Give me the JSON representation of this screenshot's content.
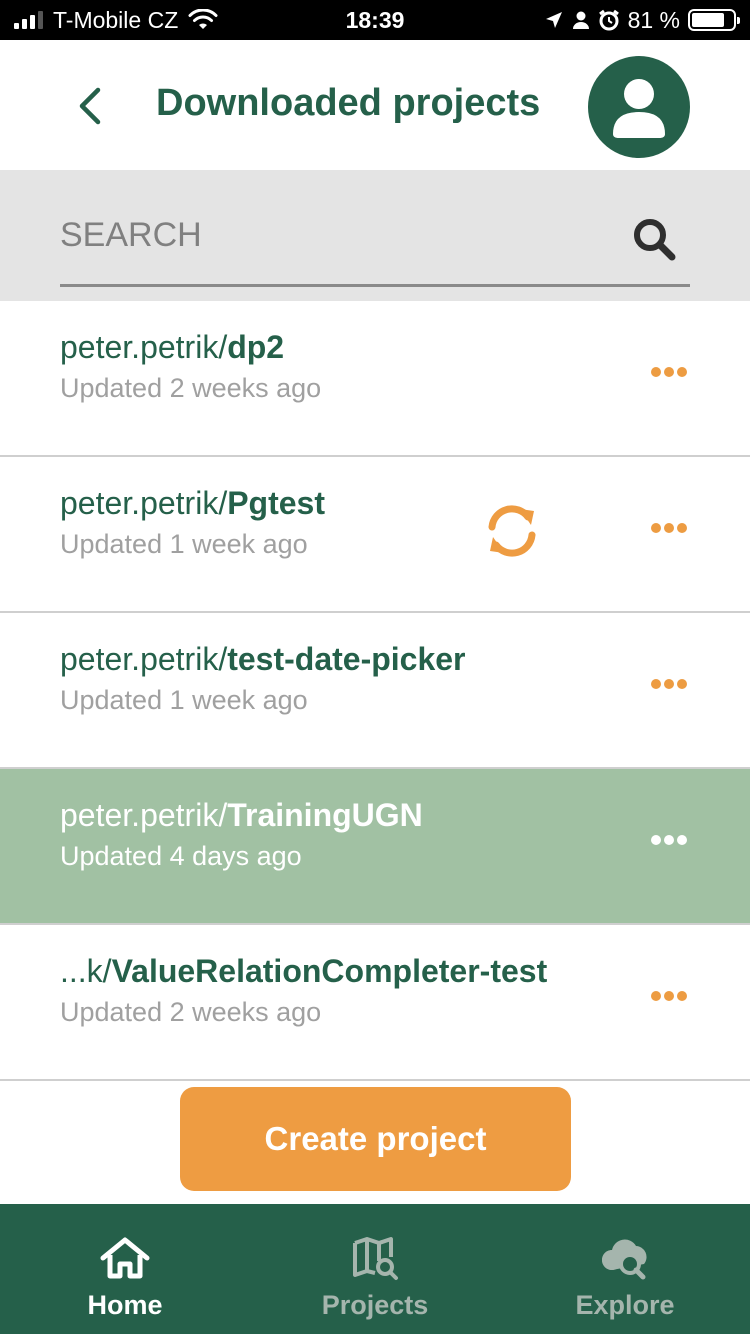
{
  "status_bar": {
    "carrier": "T-Mobile CZ",
    "time": "18:39",
    "battery_percent": "81 %",
    "battery_level": 0.81
  },
  "header": {
    "title": "Downloaded projects",
    "back_icon": "chevron-left-icon",
    "avatar_icon": "user-icon"
  },
  "search": {
    "placeholder": "SEARCH",
    "value": "",
    "icon": "search-icon"
  },
  "projects": [
    {
      "namespace": "peter.petrik/",
      "name": "dp2",
      "updated": "Updated 2 weeks ago",
      "selected": false,
      "sync": false
    },
    {
      "namespace": "peter.petrik/",
      "name": "Pgtest",
      "updated": "Updated 1 week ago",
      "selected": false,
      "sync": true
    },
    {
      "namespace": "peter.petrik/",
      "name": "test-date-picker",
      "updated": "Updated 1 week ago",
      "selected": false,
      "sync": false
    },
    {
      "namespace": "peter.petrik/",
      "name": "TrainingUGN",
      "updated": "Updated 4 days ago",
      "selected": true,
      "sync": false
    },
    {
      "namespace": "...k/",
      "name": "ValueRelationCompleter-test",
      "updated": "Updated 2 weeks ago",
      "selected": false,
      "sync": false
    }
  ],
  "create_button": {
    "label": "Create project"
  },
  "bottom_nav": {
    "items": [
      {
        "label": "Home",
        "icon": "home-icon",
        "active": true
      },
      {
        "label": "Projects",
        "icon": "map-search-icon",
        "active": false
      },
      {
        "label": "Explore",
        "icon": "cloud-search-icon",
        "active": false
      }
    ]
  },
  "colors": {
    "brand_green": "#25604a",
    "accent_orange": "#ee9c42",
    "selected_row": "#a1c1a3",
    "search_bg": "#e4e4e4"
  }
}
